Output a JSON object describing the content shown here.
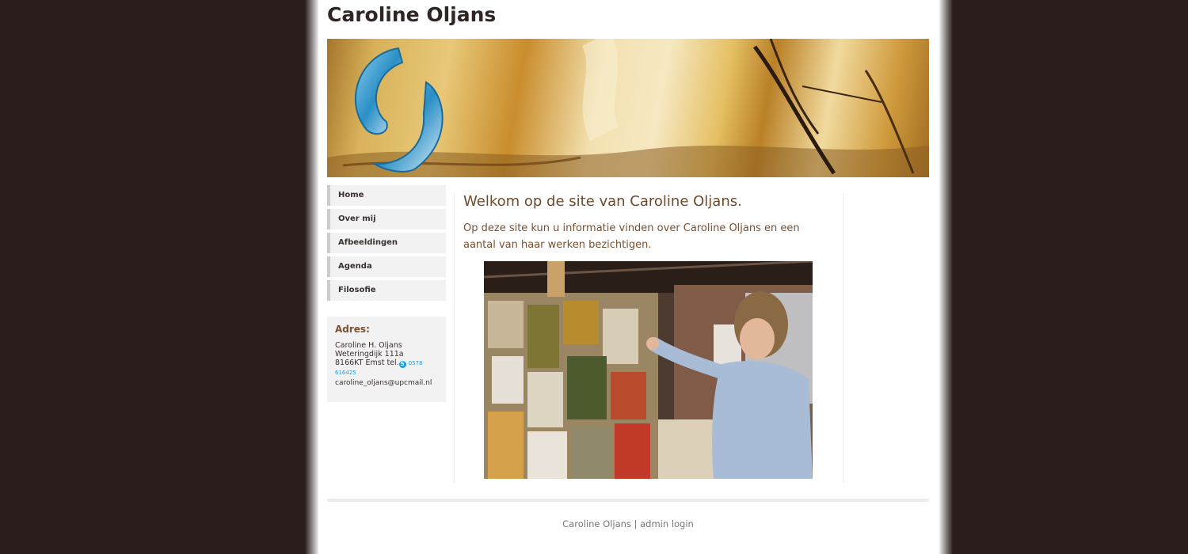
{
  "site": {
    "title": "Caroline Oljans"
  },
  "nav": {
    "items": [
      {
        "label": "Home"
      },
      {
        "label": "Over mij"
      },
      {
        "label": "Afbeeldingen"
      },
      {
        "label": "Agenda"
      },
      {
        "label": "Filosofie"
      }
    ]
  },
  "address": {
    "heading": "Adres:",
    "name": "Caroline H. Oljans",
    "street": "Weteringdijk 111a",
    "city": "8166KT Emst tel.",
    "phone": "0578 616425",
    "email": "caroline_oljans@upcmail.nl"
  },
  "main": {
    "heading": "Welkom op de site van Caroline Oljans.",
    "intro": "Op deze site kun u informatie vinden over Caroline Oljans en een aantal van haar werken bezichtigen."
  },
  "footer": {
    "name": "Caroline Oljans",
    "separator": " | ",
    "admin_link": "admin login"
  },
  "colors": {
    "background": "#2b1d1b",
    "accent_brown": "#7a5030",
    "nav_bg": "#f2f2f2",
    "phone_link": "#2a9ad8"
  },
  "icons": {
    "phone": "skype-icon"
  }
}
